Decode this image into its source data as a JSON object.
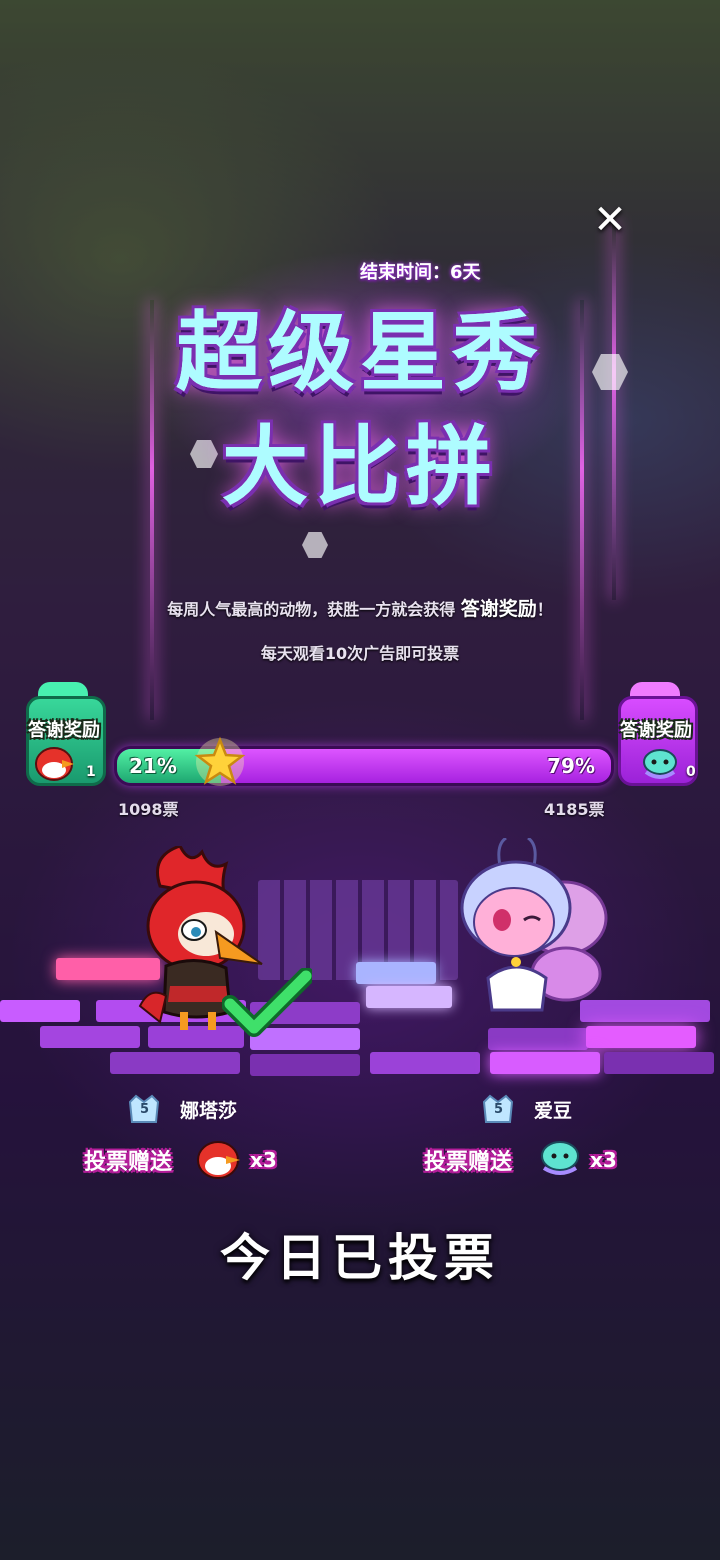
{
  "event": {
    "end_time": "结束时间：6天",
    "title_line1": "超级星秀",
    "title_line2": "大比拼",
    "description_prefix": "每周人气最高的动物，获胜一方就会获得",
    "description_highlight": "答谢奖励",
    "description_suffix": "！",
    "ad_hint": "每天观看10次广告即可投票"
  },
  "reward_left": {
    "label": "答谢奖励",
    "count": "1"
  },
  "reward_right": {
    "label": "答谢奖励",
    "count": "0"
  },
  "progress": {
    "left_pct": "21%",
    "right_pct": "79%",
    "left_fraction": 0.21,
    "left_votes": "1098票",
    "right_votes": "4185票"
  },
  "contestants": [
    {
      "name": "娜塔莎",
      "level": "5",
      "gift_label": "投票赠送",
      "multiplier": "x3"
    },
    {
      "name": "爱豆",
      "level": "5",
      "gift_label": "投票赠送",
      "multiplier": "x3"
    }
  ],
  "status": {
    "voted_today": "今日已投票"
  },
  "colors": {
    "left_team": "#2fcf8a",
    "right_team": "#b52cf0",
    "title": "#aefcff"
  },
  "icons": {
    "close": "close-icon",
    "star": "star-icon",
    "check": "checkmark-icon"
  }
}
